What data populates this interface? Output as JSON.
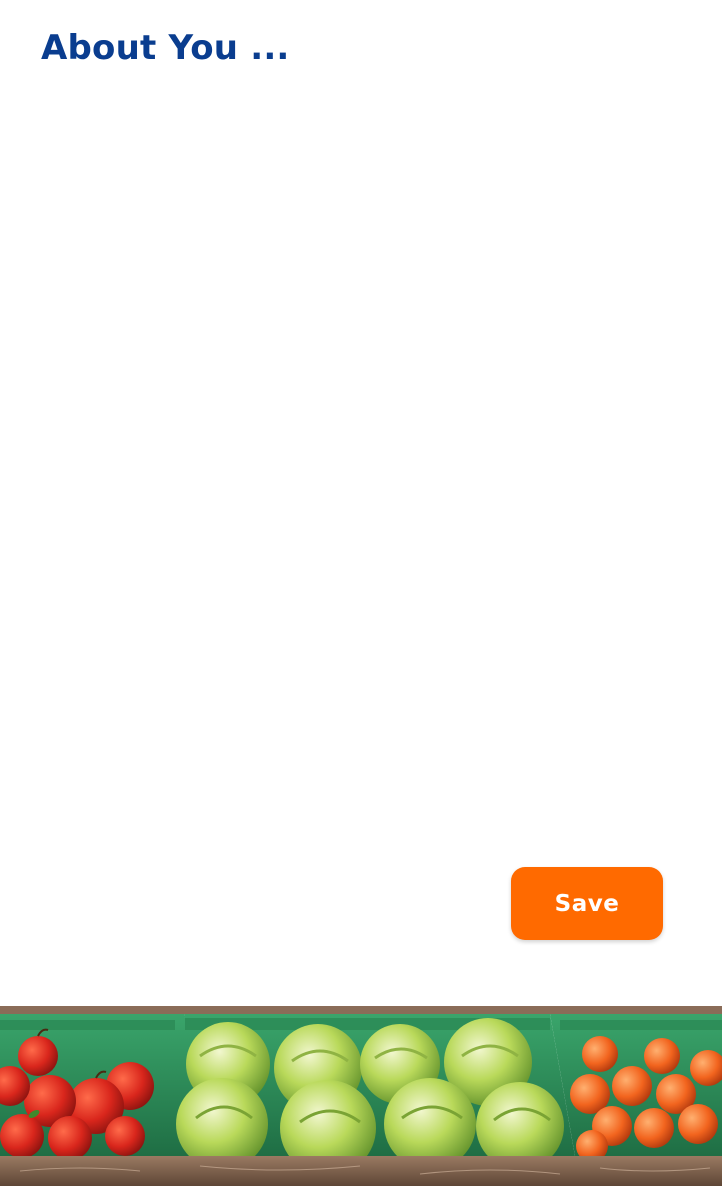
{
  "page": {
    "title": "About You ..."
  },
  "actions": {
    "save_label": "Save"
  },
  "colors": {
    "title": "#0a3d8f",
    "save_button": "#ff6a00",
    "crate_green": "#2f8f5a",
    "shelf_wood": "#7a5a45"
  },
  "illustration": {
    "name": "produce-stand",
    "items": [
      "apples-crate",
      "lettuce-crate",
      "oranges-crate"
    ]
  }
}
